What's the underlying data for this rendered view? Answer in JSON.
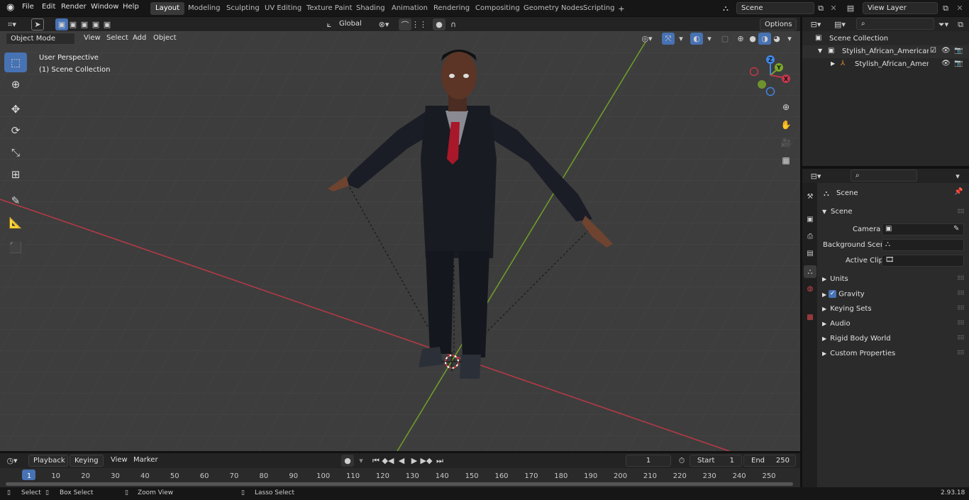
{
  "menus": [
    "File",
    "Edit",
    "Render",
    "Window",
    "Help"
  ],
  "workspaces": [
    "Layout",
    "Modeling",
    "Sculpting",
    "UV Editing",
    "Texture Paint",
    "Shading",
    "Animation",
    "Rendering",
    "Compositing",
    "Geometry Nodes",
    "Scripting"
  ],
  "scene_name": "Scene",
  "view_layer": "View Layer",
  "transform_orientation": "Global",
  "options_label": "Options",
  "viewport_header": {
    "mode": "Object Mode",
    "view": "View",
    "select": "Select",
    "add": "Add",
    "object": "Object"
  },
  "viewport_overlay": {
    "perspective": "User Perspective",
    "collection": "(1) Scene Collection"
  },
  "gizmo": {
    "x": "X",
    "y": "Y",
    "z": "Z"
  },
  "outliner": {
    "root": "Scene Collection",
    "items": [
      "Stylish_African_American_Bus",
      "Stylish_African_Americar"
    ]
  },
  "properties": {
    "context": "Scene",
    "panel_title": "Scene",
    "camera_label": "Camera",
    "background_label": "Background Scene",
    "clip_label": "Active Clip",
    "subpanels": [
      "Units",
      "Gravity",
      "Keying Sets",
      "Audio",
      "Rigid Body World",
      "Custom Properties"
    ],
    "gravity_checked": true
  },
  "timeline": {
    "playback": "Playback",
    "keying": "Keying",
    "view": "View",
    "marker": "Marker",
    "current_frame": "1",
    "start_label": "Start",
    "start": "1",
    "end_label": "End",
    "end": "250",
    "ticks": [
      "1",
      "10",
      "20",
      "30",
      "40",
      "50",
      "60",
      "70",
      "80",
      "90",
      "100",
      "110",
      "120",
      "130",
      "140",
      "150",
      "160",
      "170",
      "180",
      "190",
      "200",
      "210",
      "220",
      "230",
      "240",
      "250"
    ]
  },
  "status_bar": {
    "select": "Select",
    "box_select": "Box Select",
    "zoom_view": "Zoom View",
    "lasso_select": "Lasso Select",
    "version": "2.93.18"
  },
  "colors": {
    "accent": "#4772b3",
    "x_axis": "#c2374b",
    "y_axis": "#7aa72c",
    "z_axis": "#3f86e5",
    "viewport_bg": "#3d3d3d"
  }
}
